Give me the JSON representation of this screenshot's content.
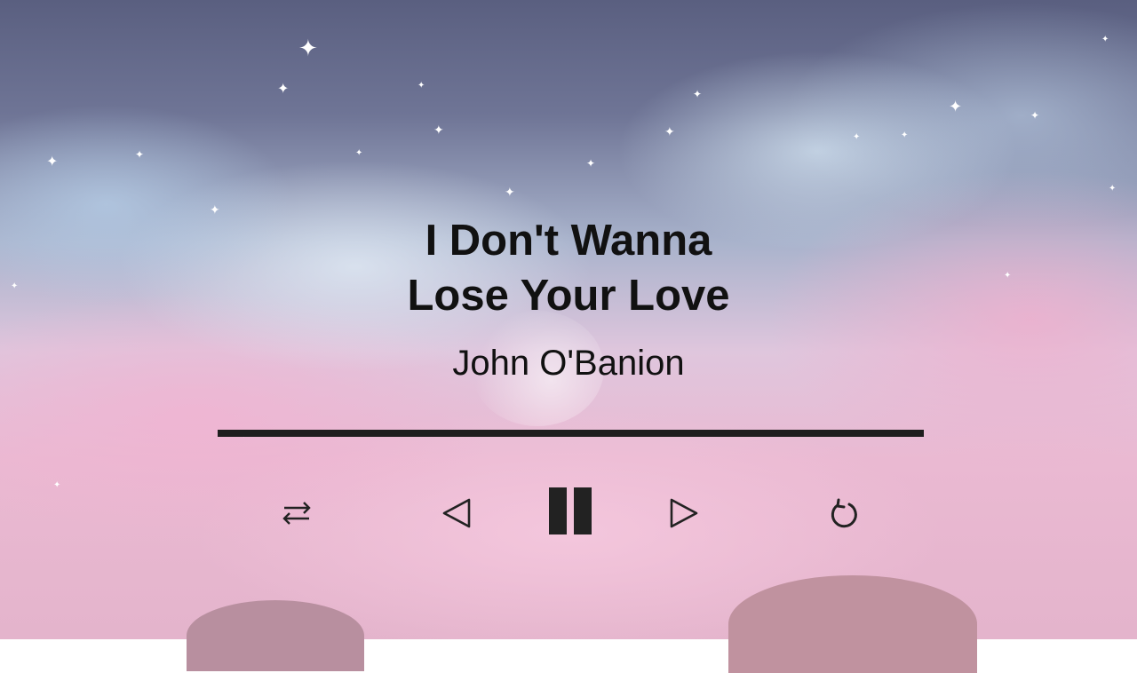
{
  "track": {
    "title_line1": "I Don't Wanna",
    "title_line2": "Lose Your Love",
    "artist": "John O'Banion"
  },
  "player": {
    "progress_fraction": 1.0,
    "state": "playing",
    "controls": [
      {
        "name": "shuffle-icon",
        "glyph": "⇆"
      },
      {
        "name": "previous-icon",
        "glyph": "◁"
      },
      {
        "name": "pause-icon",
        "glyph": "❚❚"
      },
      {
        "name": "next-icon",
        "glyph": "▷"
      },
      {
        "name": "repeat-icon",
        "glyph": "↻"
      }
    ]
  },
  "colors": {
    "text": "#111111",
    "controls": "#222222",
    "progress_bar": "#1e1e1e",
    "sky_top": "#5a5f80",
    "clouds_pink": "#eab9d2",
    "clouds_blue": "#c8dcef"
  }
}
